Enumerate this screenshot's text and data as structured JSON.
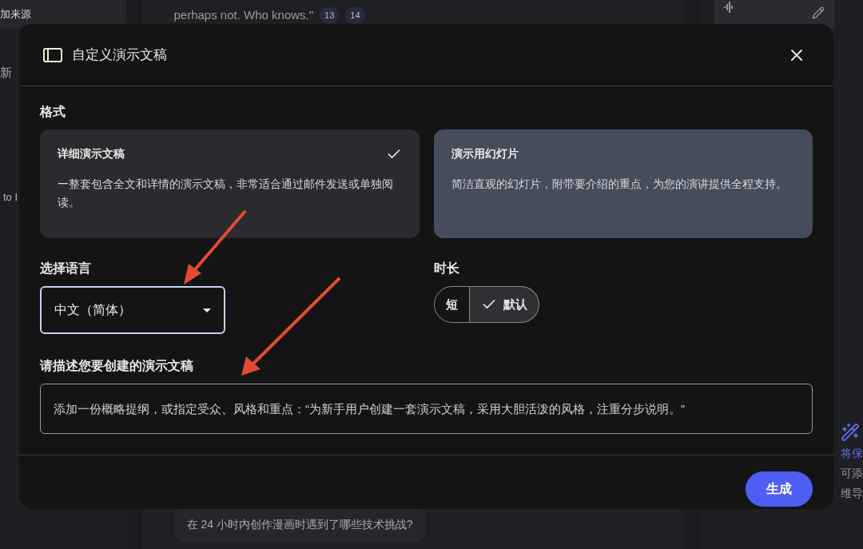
{
  "background": {
    "left_panel": {
      "texts": [
        "加来源",
        "新",
        "to I"
      ]
    },
    "chat": {
      "quote": "perhaps not. Who knows.\"",
      "citations": [
        "13",
        "14"
      ],
      "suggestion": "在 24 小时内创作漫画时遇到了哪些技术挑战?"
    },
    "studio": {
      "notes": [
        "将保",
        "可添",
        "维导"
      ]
    }
  },
  "dialog": {
    "title": "自定义演示文稿",
    "format_label": "格式",
    "formats": [
      {
        "title": "详细演示文稿",
        "description": "一整套包含全文和详情的演示文稿，非常适合通过邮件发送或单独阅读。",
        "selected": true
      },
      {
        "title": "演示用幻灯片",
        "description": "简洁直观的幻灯片，附带要介绍的重点，为您的演讲提供全程支持。",
        "selected": false
      }
    ],
    "language_label": "选择语言",
    "language": "中文（简体）",
    "duration_label": "时长",
    "durations": [
      {
        "label": "短",
        "selected": false
      },
      {
        "label": "默认",
        "selected": true
      }
    ],
    "describe_label": "请描述您要创建的演示文稿",
    "describe_placeholder": "添加一份概略提纲，或指定受众、风格和重点：“为新手用户创建一套演示文稿，采用大胆活泼的风格，注重分步说明。”",
    "submit": "生成"
  }
}
